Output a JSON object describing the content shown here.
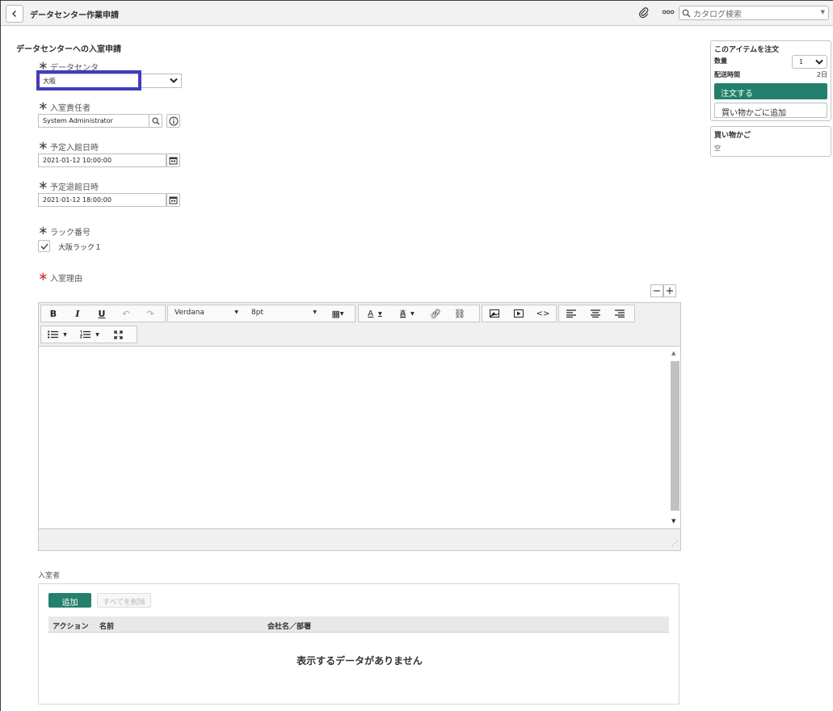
{
  "header": {
    "title": "データセンター作業申請",
    "search_placeholder": "カタログ検索"
  },
  "form": {
    "section_title": "データセンターへの入室申請",
    "datacenter": {
      "label": "データセンタ",
      "value": "大阪"
    },
    "responsible": {
      "label": "入室責任者",
      "value": "System Administrator"
    },
    "entry_datetime": {
      "label": "予定入館日時",
      "value": "2021-01-12 10:00:00"
    },
    "exit_datetime": {
      "label": "予定退館日時",
      "value": "2021-01-12 18:00:00"
    },
    "rack": {
      "label": "ラック番号",
      "option": "大阪ラック１",
      "checked": true
    },
    "reason": {
      "label": "入室理由"
    }
  },
  "editor": {
    "font_family": "Verdana",
    "font_size": "8pt",
    "expand_minus": "−",
    "expand_plus": "+"
  },
  "entrants": {
    "label": "入室者",
    "add_label": "追加",
    "clear_label": "すべてを削除",
    "columns": [
      "アクション",
      "名前",
      "会社名／部署"
    ],
    "empty_message": "表示するデータがありません"
  },
  "order": {
    "title": "このアイテムを注文",
    "qty_label": "数量",
    "qty_value": "1",
    "delivery_label": "配送時間",
    "delivery_value": "2日",
    "order_button": "注文する",
    "cart_button": "買い物かごに追加"
  },
  "cart": {
    "title": "買い物かご",
    "status": "空"
  },
  "colors": {
    "primary": "#23806d",
    "highlight": "#3e3ebe",
    "required_red": "#c83232"
  }
}
